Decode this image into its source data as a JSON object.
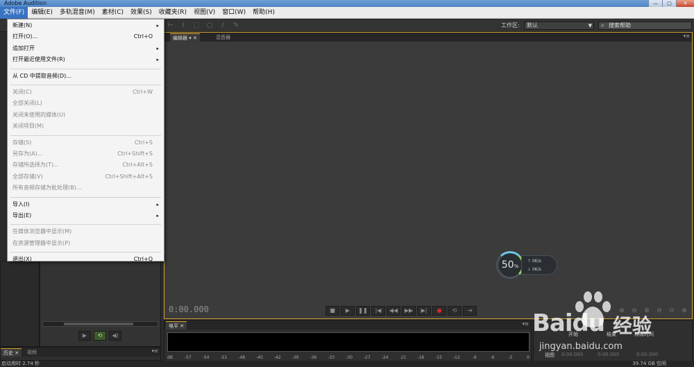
{
  "window": {
    "title": "Adobe Audition",
    "min": "—",
    "max": "□",
    "close": "✕"
  },
  "menubar": [
    {
      "label": "文件(F)",
      "active": true
    },
    {
      "label": "编辑(E)"
    },
    {
      "label": "多轨混音(M)"
    },
    {
      "label": "素材(C)"
    },
    {
      "label": "效果(S)"
    },
    {
      "label": "收藏夹(R)"
    },
    {
      "label": "视图(V)"
    },
    {
      "label": "窗口(W)"
    },
    {
      "label": "帮助(H)"
    }
  ],
  "toolbar": {
    "workspace_label": "工作区:",
    "workspace_value": "默认",
    "search_placeholder": "搜索帮助"
  },
  "file_menu": [
    {
      "label": "新建(N)",
      "submenu": true
    },
    {
      "label": "打开(O)...",
      "shortcut": "Ctrl+O"
    },
    {
      "label": "追加打开",
      "submenu": true
    },
    {
      "label": "打开最近使用文件(R)",
      "submenu": true
    },
    {
      "sep": true
    },
    {
      "label": "从 CD 中提取音频(D)..."
    },
    {
      "sep": true
    },
    {
      "label": "关闭(C)",
      "shortcut": "Ctrl+W",
      "disabled": true
    },
    {
      "label": "全部关闭(L)",
      "disabled": true
    },
    {
      "label": "关闭未使用的媒体(U)",
      "disabled": true
    },
    {
      "label": "关闭项目(M)",
      "disabled": true
    },
    {
      "sep": true
    },
    {
      "label": "存储(S)",
      "shortcut": "Ctrl+S",
      "disabled": true
    },
    {
      "label": "另存为(A)...",
      "shortcut": "Ctrl+Shift+S",
      "disabled": true
    },
    {
      "label": "存储所选择为(T)...",
      "shortcut": "Ctrl+Alt+S",
      "disabled": true
    },
    {
      "label": "全部存储(V)",
      "shortcut": "Ctrl+Shift+Alt+S",
      "disabled": true
    },
    {
      "label": "所有音频存储为批处理(B)...",
      "disabled": true
    },
    {
      "sep": true
    },
    {
      "label": "导入(I)",
      "submenu": true
    },
    {
      "label": "导出(E)",
      "submenu": true
    },
    {
      "sep": true
    },
    {
      "label": "在媒体浏览器中显示(M)",
      "disabled": true
    },
    {
      "label": "在资源管理器中显示(P)",
      "disabled": true
    },
    {
      "sep": true
    },
    {
      "label": "退出(X)",
      "shortcut": "Ctrl+Q"
    }
  ],
  "editor": {
    "tabs": [
      {
        "label": "编辑器",
        "active": true
      },
      {
        "label": "混音器"
      }
    ],
    "timecode": "0:00.000"
  },
  "performance": {
    "cpu": "50",
    "cpu_unit": "%",
    "upload": "0",
    "download": "0",
    "rate_unit": "K/s"
  },
  "levels": {
    "tab": "电平",
    "scale": [
      "dB",
      "-57",
      "-54",
      "-51",
      "-48",
      "-45",
      "-42",
      "-39",
      "-36",
      "-33",
      "-30",
      "-27",
      "-24",
      "-21",
      "-18",
      "-15",
      "-12",
      "-9",
      "-6",
      "-3",
      "0"
    ]
  },
  "selection_view": {
    "headers": [
      "开始",
      "结束",
      "持续时间"
    ],
    "row_label": "视图",
    "values": [
      "0:00.000",
      "0:00.000",
      "0:00.000"
    ]
  },
  "history_tabs": [
    "历史",
    "视频"
  ],
  "status": {
    "left": "启动用时 2.74 秒",
    "right": "39.74 GB 空闲"
  },
  "watermark": {
    "brand": "Baidu",
    "brand2": "经验",
    "url": "jingyan.baidu.com"
  }
}
